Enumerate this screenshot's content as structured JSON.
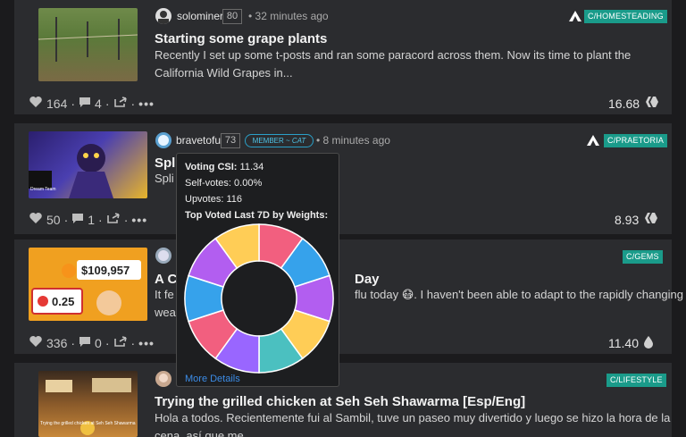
{
  "posts": [
    {
      "author": "solominer",
      "reputation": "80",
      "time": "32 minutes ago",
      "community": "C/HOMESTEADING",
      "title": "Starting some grape plants",
      "summary_line1": "Recently I set up some t-posts and ran some paracord across them. Now its time to plant the",
      "summary_line2": "California Wild Grapes in...",
      "votes": "164",
      "comments": "4",
      "payout": "16.68"
    },
    {
      "author": "bravetofu",
      "reputation": "73",
      "member_prefix": "MEMBER ~ ",
      "member_role": "CAT",
      "time": "8 minutes ago",
      "community": "C/PRAETORIA",
      "title": "Spli",
      "summary": "Spli",
      "votes": "50",
      "comments": "1",
      "payout": "8.93",
      "thumb_text": "Dream Team"
    },
    {
      "community": "C/GEMS",
      "title_left": "A C",
      "title_right": "Day",
      "summary_left": "It fe",
      "summary_right": "flu today 😷. I haven't been able to adapt to the rapidly changing",
      "summary_line2": "wea",
      "votes": "336",
      "comments": "0",
      "payout": "11.40",
      "thumb_price": "$109,957",
      "thumb_value": "0.25"
    },
    {
      "community": "C/LIFESTYLE",
      "title": "Trying the grilled chicken at Seh Seh Shawarma [Esp/Eng]",
      "summary_line1": "Hola a todos. Recientemente fui al Sambil, tuve un paseo muy divertido y luego se hizo la hora de la",
      "summary_line2": "cena, así que me...",
      "thumb_caption": "Trying the grilled chicken at Seh Seh Shawarma"
    }
  ],
  "popover": {
    "csi_label": "Voting CSI:",
    "csi_value": "11.34",
    "self_label": "Self-votes:",
    "self_value": "0.00%",
    "upvotes_label": "Upvotes:",
    "upvotes_value": "116",
    "top_label": "Top Voted Last 7D by Weights:",
    "more_details": "More Details",
    "donut_slices": [
      {
        "color": "#f25f7f",
        "weight": 1
      },
      {
        "color": "#36a2eb",
        "weight": 1
      },
      {
        "color": "#b25ef0",
        "weight": 1
      },
      {
        "color": "#ffcd56",
        "weight": 1
      },
      {
        "color": "#4bc0c0",
        "weight": 1
      },
      {
        "color": "#9966ff",
        "weight": 1
      },
      {
        "color": "#f25f7f",
        "weight": 1
      },
      {
        "color": "#36a2eb",
        "weight": 1
      },
      {
        "color": "#b25ef0",
        "weight": 1
      },
      {
        "color": "#ffcd56",
        "weight": 1
      }
    ]
  },
  "icons": {
    "upvote": "heart-icon",
    "comment": "comment-icon",
    "reblog": "reblog-icon",
    "more": "more-icon",
    "hive": "hive-icon",
    "hbd": "droplet-icon",
    "community": "community-logo-icon"
  }
}
